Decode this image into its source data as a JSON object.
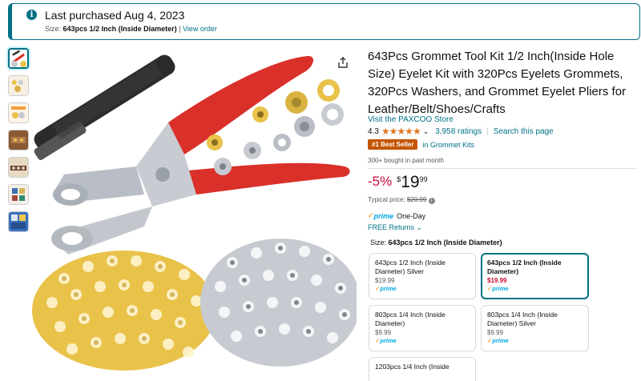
{
  "banner": {
    "main_text": "Last purchased Aug 4, 2023",
    "size_label": "Size:",
    "size_value": "643pcs 1/2 Inch (Inside Diameter)",
    "separator": "|",
    "view_order": "View order"
  },
  "product": {
    "title": "643Pcs Grommet Tool Kit 1/2 Inch(Inside Hole Size) Eyelet Kit with 320Pcs Eyelets Grommets, 320Pcs Washers, and Grommet Eyelet Pliers for Leather/Belt/Shoes/Crafts",
    "store_link": "Visit the PAXCOO Store",
    "rating_value": "4.3",
    "stars": "★★★★★",
    "ratings_count": "3,958 ratings",
    "search_page": "Search this page",
    "rating_separator": "|",
    "best_seller_badge": "#1 Best Seller",
    "best_seller_category": "in Grommet Kits",
    "bought_text": "300+ bought in past month",
    "discount": "-5%",
    "currency": "$",
    "price_whole": "19",
    "price_fraction": "99",
    "typical_label": "Typical price:",
    "typical_price": "$20.99",
    "prime_label": "prime",
    "prime_delivery": "One-Day",
    "free_returns": "FREE Returns",
    "size_label": "Size:",
    "size_selected": "643pcs 1/2 Inch (Inside Diameter)"
  },
  "size_options": [
    {
      "name": "643pcs 1/2 Inch (Inside Diameter) Silver",
      "price": "$19.99",
      "prime": "prime"
    },
    {
      "name": "643pcs 1/2 Inch (Inside Diameter)",
      "price": "$19.99",
      "prime": "prime"
    },
    {
      "name": "803pcs 1/4 Inch (Inside Diameter)",
      "price": "$9.99",
      "prime": "prime"
    },
    {
      "name": "803pcs 1/4 Inch (Inside Diameter) Silver",
      "price": "$9.99",
      "prime": "prime"
    },
    {
      "name": "1203pcs 1/4 Inch (Inside",
      "price": "",
      "prime": ""
    }
  ],
  "colors": {
    "link": "#007185",
    "deal_red": "#CC0C39",
    "star": "#DE7921",
    "badge": "#C45500",
    "prime_blue": "#00A8E1",
    "handle_red": "#D9302A",
    "gold": "#E9C24A",
    "silver": "#C7CBD1"
  }
}
